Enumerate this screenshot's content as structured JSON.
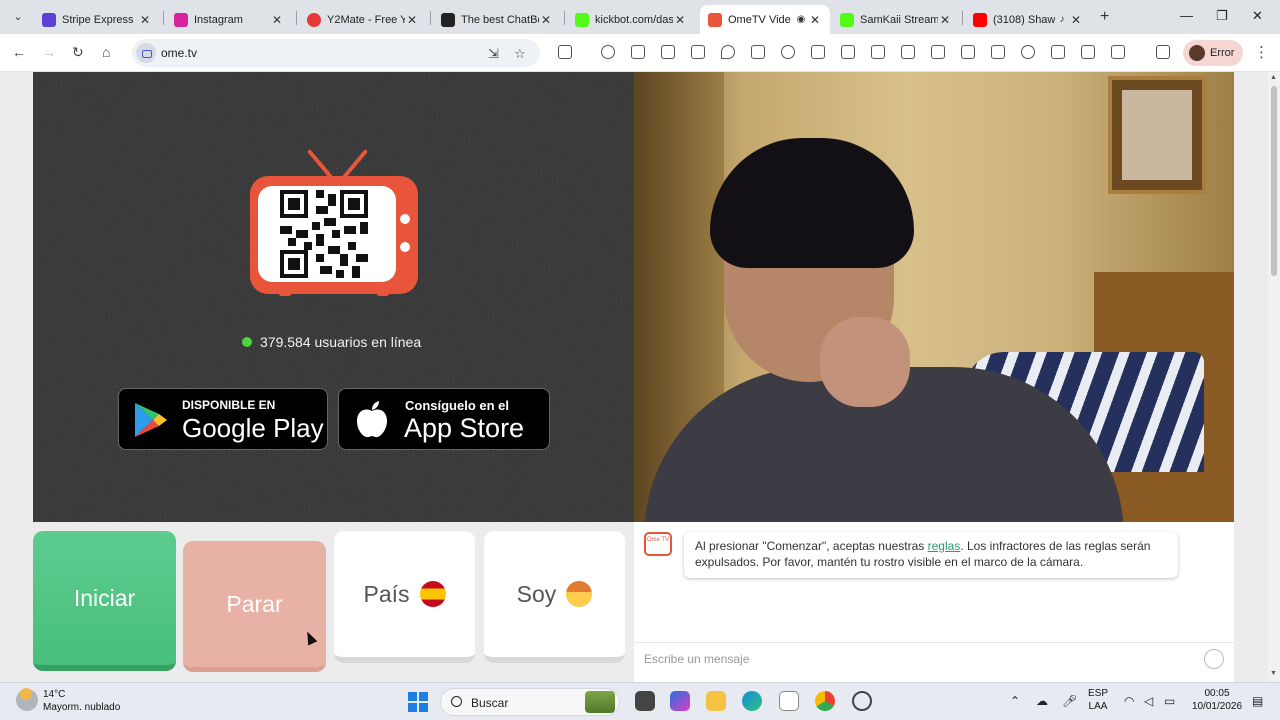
{
  "browser": {
    "tabs": [
      {
        "title": "Stripe Express",
        "favicon_color": "#5b3fd6"
      },
      {
        "title": "Instagram",
        "favicon_color": "#d6249f"
      },
      {
        "title": "Y2Mate - Free Y",
        "favicon_color": "#e53935"
      },
      {
        "title": "The best ChatBo",
        "favicon_color": "#222222"
      },
      {
        "title": "kickbot.com/das",
        "favicon_color": "#53fc18"
      },
      {
        "title": "OmeTV Vide",
        "favicon_color": "#e8553a"
      },
      {
        "title": "SamKaii Stream",
        "favicon_color": "#53fc18"
      },
      {
        "title": "(3108) Shaw",
        "favicon_color": "#ff0000"
      }
    ],
    "url": "ome.tv",
    "profile_label": "Error"
  },
  "page": {
    "online_count": "379.584 usuarios en línea",
    "google_play": {
      "small": "DISPONIBLE EN",
      "big": "Google Play"
    },
    "app_store": {
      "small": "Consíguelo en el",
      "big": "App Store"
    },
    "buttons": {
      "start": "Iniciar",
      "stop": "Parar",
      "country": "País",
      "soy": "Soy"
    },
    "chat": {
      "logo_text": "Ome TV",
      "message_before": "Al presionar \"Comenzar\", aceptas nuestras ",
      "rules_link": "reglas",
      "message_after": ". Los infractores de las reglas serán expulsados. Por favor, mantén tu rostro visible en el marco de la cámara.",
      "input_placeholder": "Escribe un mensaje"
    }
  },
  "taskbar": {
    "temperature": "14°C",
    "weather": "Mayorm. nublado",
    "search": "Buscar",
    "lang_top": "ESP",
    "lang_bottom": "LAA",
    "time": "00:05",
    "date": "10/01/2026"
  },
  "colors": {
    "accent_green": "#49bf7c",
    "accent_orange": "#e8553a",
    "stop_button": "#e8b1a5"
  }
}
